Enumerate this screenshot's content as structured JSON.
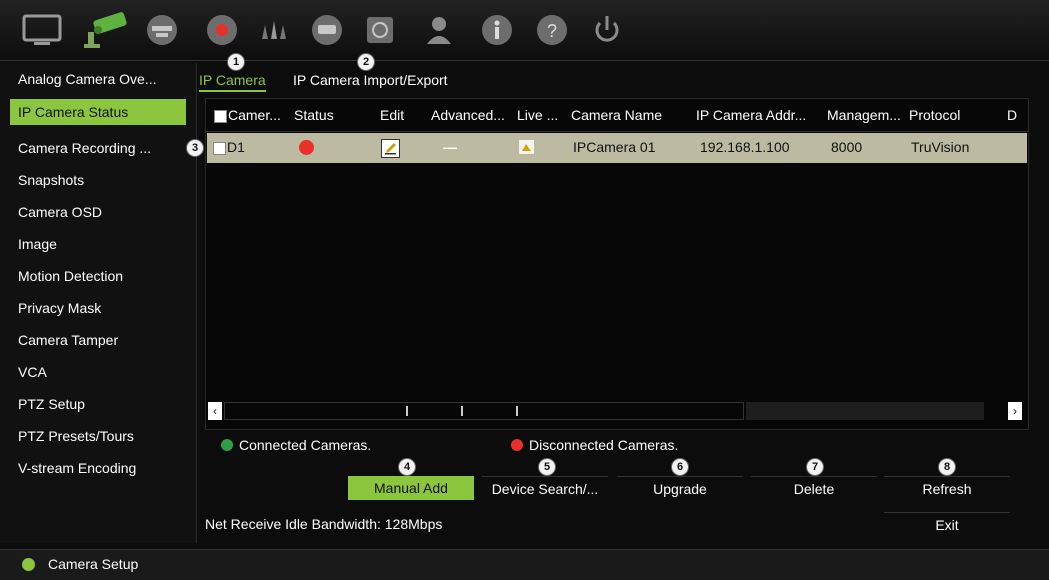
{
  "header": {
    "icons": [
      "monitor-icon",
      "camera-icon",
      "network-icon",
      "record-icon",
      "alarm-icon",
      "device-icon",
      "storage-icon",
      "user-icon",
      "info-icon",
      "help-icon",
      "power-icon"
    ]
  },
  "tabs": [
    {
      "label": "IP Camera",
      "active": true,
      "number": "1"
    },
    {
      "label": "IP Camera Import/Export",
      "active": false,
      "number": "2"
    }
  ],
  "sidebar": {
    "items": [
      {
        "label": "Analog Camera Ove...",
        "active": false
      },
      {
        "label": "IP Camera Status",
        "active": true
      },
      {
        "label": "Camera Recording ...",
        "active": false
      },
      {
        "label": "Snapshots",
        "active": false
      },
      {
        "label": "Camera OSD",
        "active": false
      },
      {
        "label": "Image",
        "active": false
      },
      {
        "label": "Motion Detection",
        "active": false
      },
      {
        "label": "Privacy Mask",
        "active": false
      },
      {
        "label": "Camera Tamper",
        "active": false
      },
      {
        "label": "VCA",
        "active": false
      },
      {
        "label": "PTZ Setup",
        "active": false
      },
      {
        "label": "PTZ Presets/Tours",
        "active": false
      },
      {
        "label": "V-stream Encoding",
        "active": false
      }
    ]
  },
  "table": {
    "columns": [
      "Camer...",
      "Status",
      "Edit",
      "Advanced...",
      "Live ...",
      "Camera Name",
      "IP Camera Addr...",
      "Managem...",
      "Protocol",
      "D"
    ],
    "row_marker": "3",
    "rows": [
      {
        "camera": "D1",
        "status": "disconnected",
        "edit": "edit-icon",
        "advanced": "—",
        "live": "live-view-icon",
        "name": "IPCamera 01",
        "ip": "192.168.1.100",
        "port": "8000",
        "protocol": "TruVision"
      }
    ]
  },
  "legend": {
    "connected": "Connected Cameras.",
    "disconnected": "Disconnected Cameras."
  },
  "buttons": [
    {
      "label": "Manual Add",
      "number": "4",
      "primary": true
    },
    {
      "label": "Device Search/...",
      "number": "5",
      "primary": false
    },
    {
      "label": "Upgrade",
      "number": "6",
      "primary": false
    },
    {
      "label": "Delete",
      "number": "7",
      "primary": false
    },
    {
      "label": "Refresh",
      "number": "8",
      "primary": false
    }
  ],
  "exit_label": "Exit",
  "bandwidth": "Net Receive Idle Bandwidth: 128Mbps",
  "footer": {
    "label": "Camera Setup"
  },
  "colors": {
    "accent": "#8cc63f",
    "connected": "#2e9e45",
    "disconnected": "#e8312a",
    "row_bg": "#bcbba1"
  }
}
